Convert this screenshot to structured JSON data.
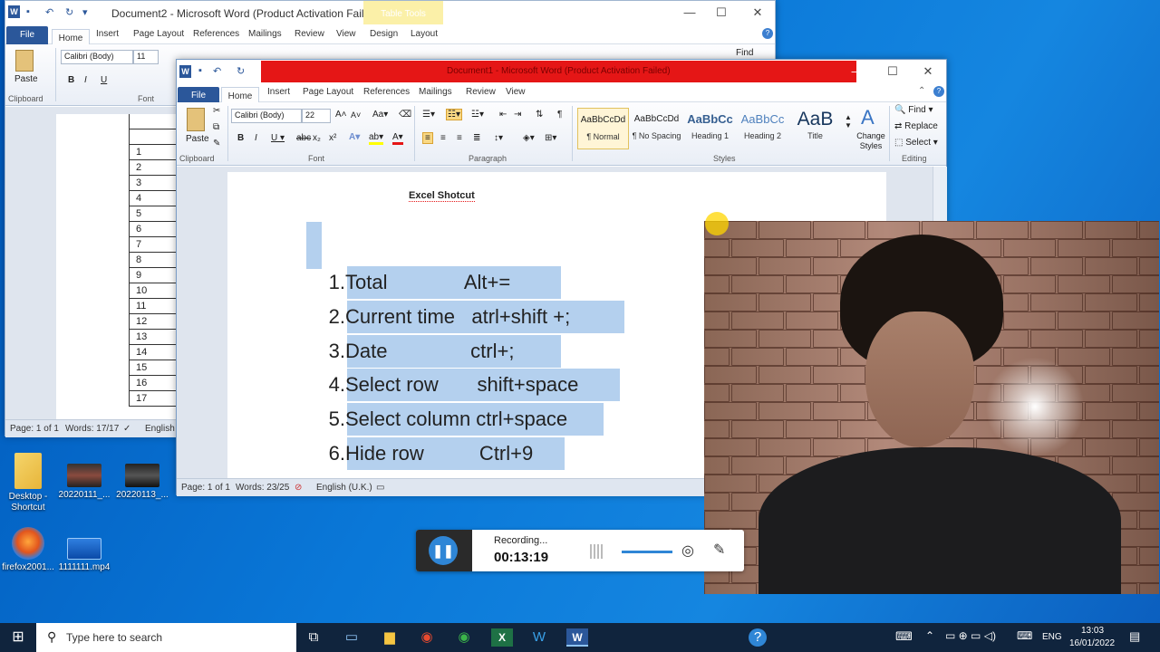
{
  "desktop": {
    "icons": [
      {
        "label": "Desktop - Shortcut"
      },
      {
        "label": "20220111_..."
      },
      {
        "label": "20220113_..."
      },
      {
        "label": "firefox2001..."
      },
      {
        "label": "1111111.mp4"
      }
    ]
  },
  "back_window": {
    "title": "Document2  -  Microsoft Word (Product Activation Failed)",
    "contextual": "Table Tools",
    "tabs": [
      "File",
      "Home",
      "Insert",
      "Page Layout",
      "References",
      "Mailings",
      "Review",
      "View",
      "Design",
      "Layout"
    ],
    "font_name": "Calibri (Body)",
    "font_size": "11",
    "paste_label": "Paste",
    "clipboard_label": "Clipboard",
    "font_group_label": "Font",
    "find_label": "Find",
    "table_rows": [
      "",
      "",
      "1",
      "2",
      "3",
      "4",
      "5",
      "6",
      "7",
      "8",
      "9",
      "10",
      "11",
      "12",
      "13",
      "14",
      "15",
      "16",
      "17"
    ],
    "status": {
      "page": "Page: 1 of 1",
      "words": "Words: 17/17",
      "lang": "English ("
    }
  },
  "front_window": {
    "title": "Document1  -  Microsoft Word (Product Activation Failed)",
    "title_bar_color": "#e51616",
    "tabs": [
      "File",
      "Home",
      "Insert",
      "Page Layout",
      "References",
      "Mailings",
      "Review",
      "View"
    ],
    "font_name": "Calibri (Body)",
    "font_size": "22",
    "paste_label": "Paste",
    "groups": {
      "clipboard": "Clipboard",
      "font": "Font",
      "paragraph": "Paragraph",
      "styles": "Styles",
      "editing": "Editing"
    },
    "styles": [
      {
        "sample": "AaBbCcDd",
        "name": "¶ Normal"
      },
      {
        "sample": "AaBbCcDd",
        "name": "¶ No Spacing"
      },
      {
        "sample": "AaBbCc",
        "name": "Heading 1"
      },
      {
        "sample": "AaBbCc",
        "name": "Heading 2"
      },
      {
        "sample": "AaB",
        "name": "Title"
      }
    ],
    "change_styles": "Change Styles",
    "editing": {
      "find": "Find",
      "replace": "Replace",
      "select": "Select"
    },
    "document": {
      "heading": "Excel Shotcut",
      "items": [
        {
          "num": "1.",
          "text": "Total              Alt+="
        },
        {
          "num": "2.",
          "text": "Current time   atrl+shift +;"
        },
        {
          "num": "3.",
          "text": "Date               ctrl+;"
        },
        {
          "num": "4.",
          "text": "Select row       shift+space"
        },
        {
          "num": "5.",
          "text": "Select column ctrl+space"
        },
        {
          "num": "6.",
          "text": "Hide row          Ctrl+9"
        }
      ]
    },
    "status": {
      "page": "Page: 1 of 1",
      "words": "Words: 23/25",
      "lang": "English (U.K.)"
    }
  },
  "recorder": {
    "state": "Recording...",
    "time": "00:13:19"
  },
  "taskbar": {
    "search_placeholder": "Type here to search",
    "lang": "ENG",
    "time": "13:03",
    "date": "16/01/2022"
  },
  "colors": {
    "word_blue": "#2b579a",
    "selection": "#b4d0ee",
    "desktop": "#0a6cd0"
  }
}
